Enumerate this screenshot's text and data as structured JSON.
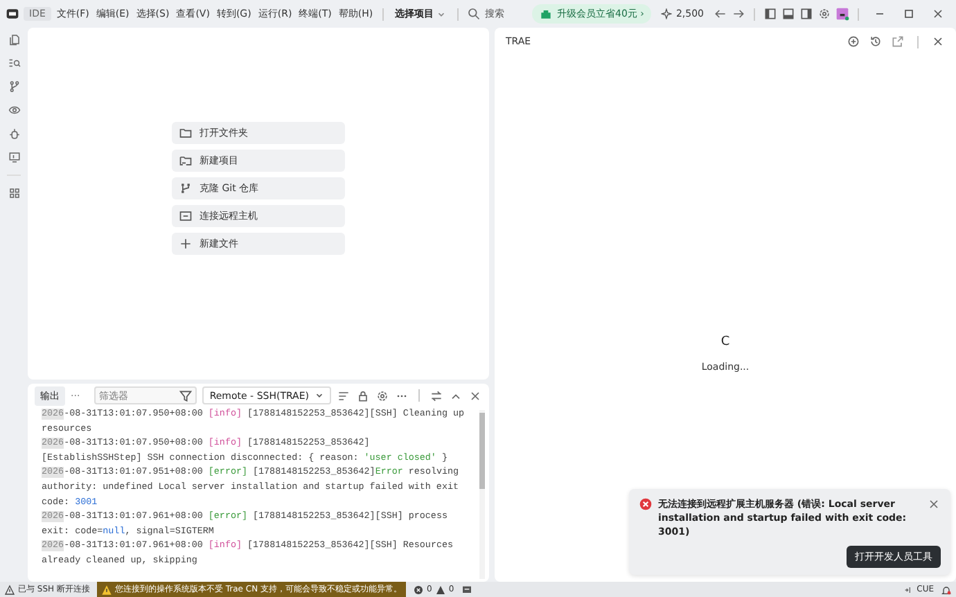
{
  "title_bar": {
    "mode": "IDE",
    "menus": [
      "文件(F)",
      "编辑(E)",
      "选择(S)",
      "查看(V)",
      "转到(G)",
      "运行(R)",
      "终端(T)",
      "帮助(H)"
    ],
    "project": "选择项目",
    "search": "搜索",
    "upgrade": "升级会员立省40元 ›",
    "credits": "2,500"
  },
  "welcome": {
    "actions": [
      "打开文件夹",
      "新建项目",
      "克隆 Git 仓库",
      "连接远程主机",
      "新建文件"
    ]
  },
  "panel": {
    "tabs": [
      {
        "label": "输出",
        "selected": true
      }
    ],
    "more": "···",
    "filter": {
      "placeholder": "筛选器"
    },
    "channel": "Remote - SSH(TRAE)",
    "log": [
      {
        "year": "2026",
        "time": "-08-31T13:01:07.950+08:00",
        "level": "[info]",
        "kind": "info",
        "message": [
          {
            "kind": "plain",
            "text": "[1788148152253_853642][SSH] Cleaning up resources"
          }
        ]
      },
      {
        "year": "2026",
        "time": "-08-31T13:01:07.950+08:00",
        "level": "[info]",
        "kind": "info",
        "message": [
          {
            "kind": "plain",
            "text": "[1788148152253_853642][EstablishSSHStep] SSH connection disconnected: { reason: "
          },
          {
            "kind": "string",
            "text": "'user closed'"
          },
          {
            "kind": "plain",
            "text": " }"
          }
        ]
      },
      {
        "year": "2026",
        "time": "-08-31T13:01:07.951+08:00",
        "level": "[error]",
        "kind": "error",
        "message": [
          {
            "kind": "plain",
            "text": "[1788148152253_853642]"
          },
          {
            "kind": "string",
            "text": "Error"
          },
          {
            "kind": "plain",
            "text": " resolving authority: undefined Local server installation and startup failed with exit code: "
          },
          {
            "kind": "number",
            "text": "3001"
          }
        ]
      },
      {
        "year": "2026",
        "time": "-08-31T13:01:07.961+08:00",
        "level": "[error]",
        "kind": "error",
        "message": [
          {
            "kind": "plain",
            "text": "[1788148152253_853642][SSH] process exit: code="
          },
          {
            "kind": "number",
            "text": "null"
          },
          {
            "kind": "plain",
            "text": ", signal=SIGTERM"
          }
        ]
      },
      {
        "year": "2026",
        "time": "-08-31T13:01:07.961+08:00",
        "level": "[info]",
        "kind": "info",
        "message": [
          {
            "kind": "plain",
            "text": "[1788148152253_853642][SSH] Resources already cleaned up, skipping"
          }
        ]
      }
    ]
  },
  "side_panel": {
    "title": "TRAE",
    "logo": "C",
    "status": "Loading..."
  },
  "notification": {
    "message": "无法连接到远程扩展主机服务器 (错误: Local server installation and startup failed with exit code: 3001)",
    "action": "打开开发人员工具"
  },
  "status_bar": {
    "remote": "已与 SSH 断开连接",
    "warning": "您连接到的操作系统版本不受 Trae CN 支持，可能会导致不稳定或功能异常。",
    "errors": "0",
    "warnings": "0",
    "cue": "CUE"
  }
}
